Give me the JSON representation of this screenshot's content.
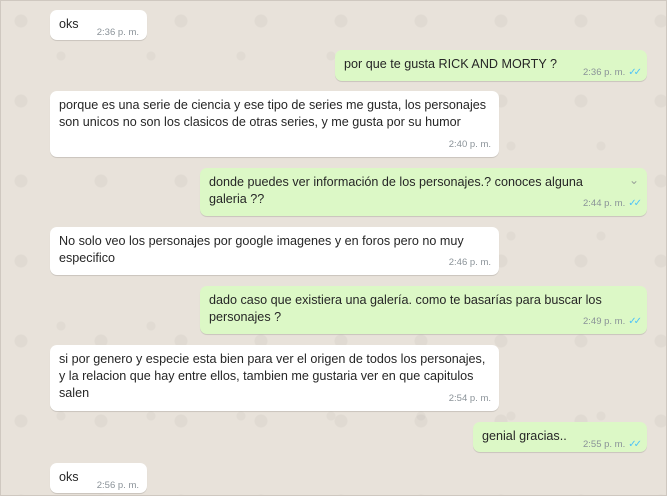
{
  "messages": [
    {
      "dir": "in",
      "text": "oks",
      "time": "2:36 p. m."
    },
    {
      "dir": "out",
      "text": "por que te gusta RICK AND MORTY ?",
      "time": "2:36 p. m."
    },
    {
      "dir": "in",
      "text": "porque es una serie de ciencia y ese tipo de series me gusta, los personajes son unicos no son los clasicos de otras series, y me gusta por su humor",
      "time": "2:40 p. m."
    },
    {
      "dir": "out",
      "text": "donde puedes ver información de los personajes.? conoces alguna galeria ??",
      "time": "2:44 p. m."
    },
    {
      "dir": "in",
      "text": "No solo veo los personajes por google imagenes y en foros pero no muy especifico",
      "time": "2:46 p. m."
    },
    {
      "dir": "out",
      "text": "dado caso que existiera una galería. como te basarías para buscar los personajes ?",
      "time": "2:49 p. m."
    },
    {
      "dir": "in",
      "text": "si por genero y especie esta bien para ver el origen de todos los personajes, y la relacion que hay entre ellos, tambien me gustaria ver en que capitulos salen",
      "time": "2:54 p. m."
    },
    {
      "dir": "out",
      "text": "genial gracias..",
      "time": "2:55 p. m."
    },
    {
      "dir": "in",
      "text": "oks",
      "time": "2:56 p. m."
    }
  ],
  "icons": {
    "read_ticks": "double-check-icon",
    "menu": "chevron-down-icon"
  },
  "colors": {
    "incoming": "#ffffff",
    "outgoing": "#dcf8c6",
    "ticks": "#4fc3f7",
    "background": "#e5ddd5"
  }
}
